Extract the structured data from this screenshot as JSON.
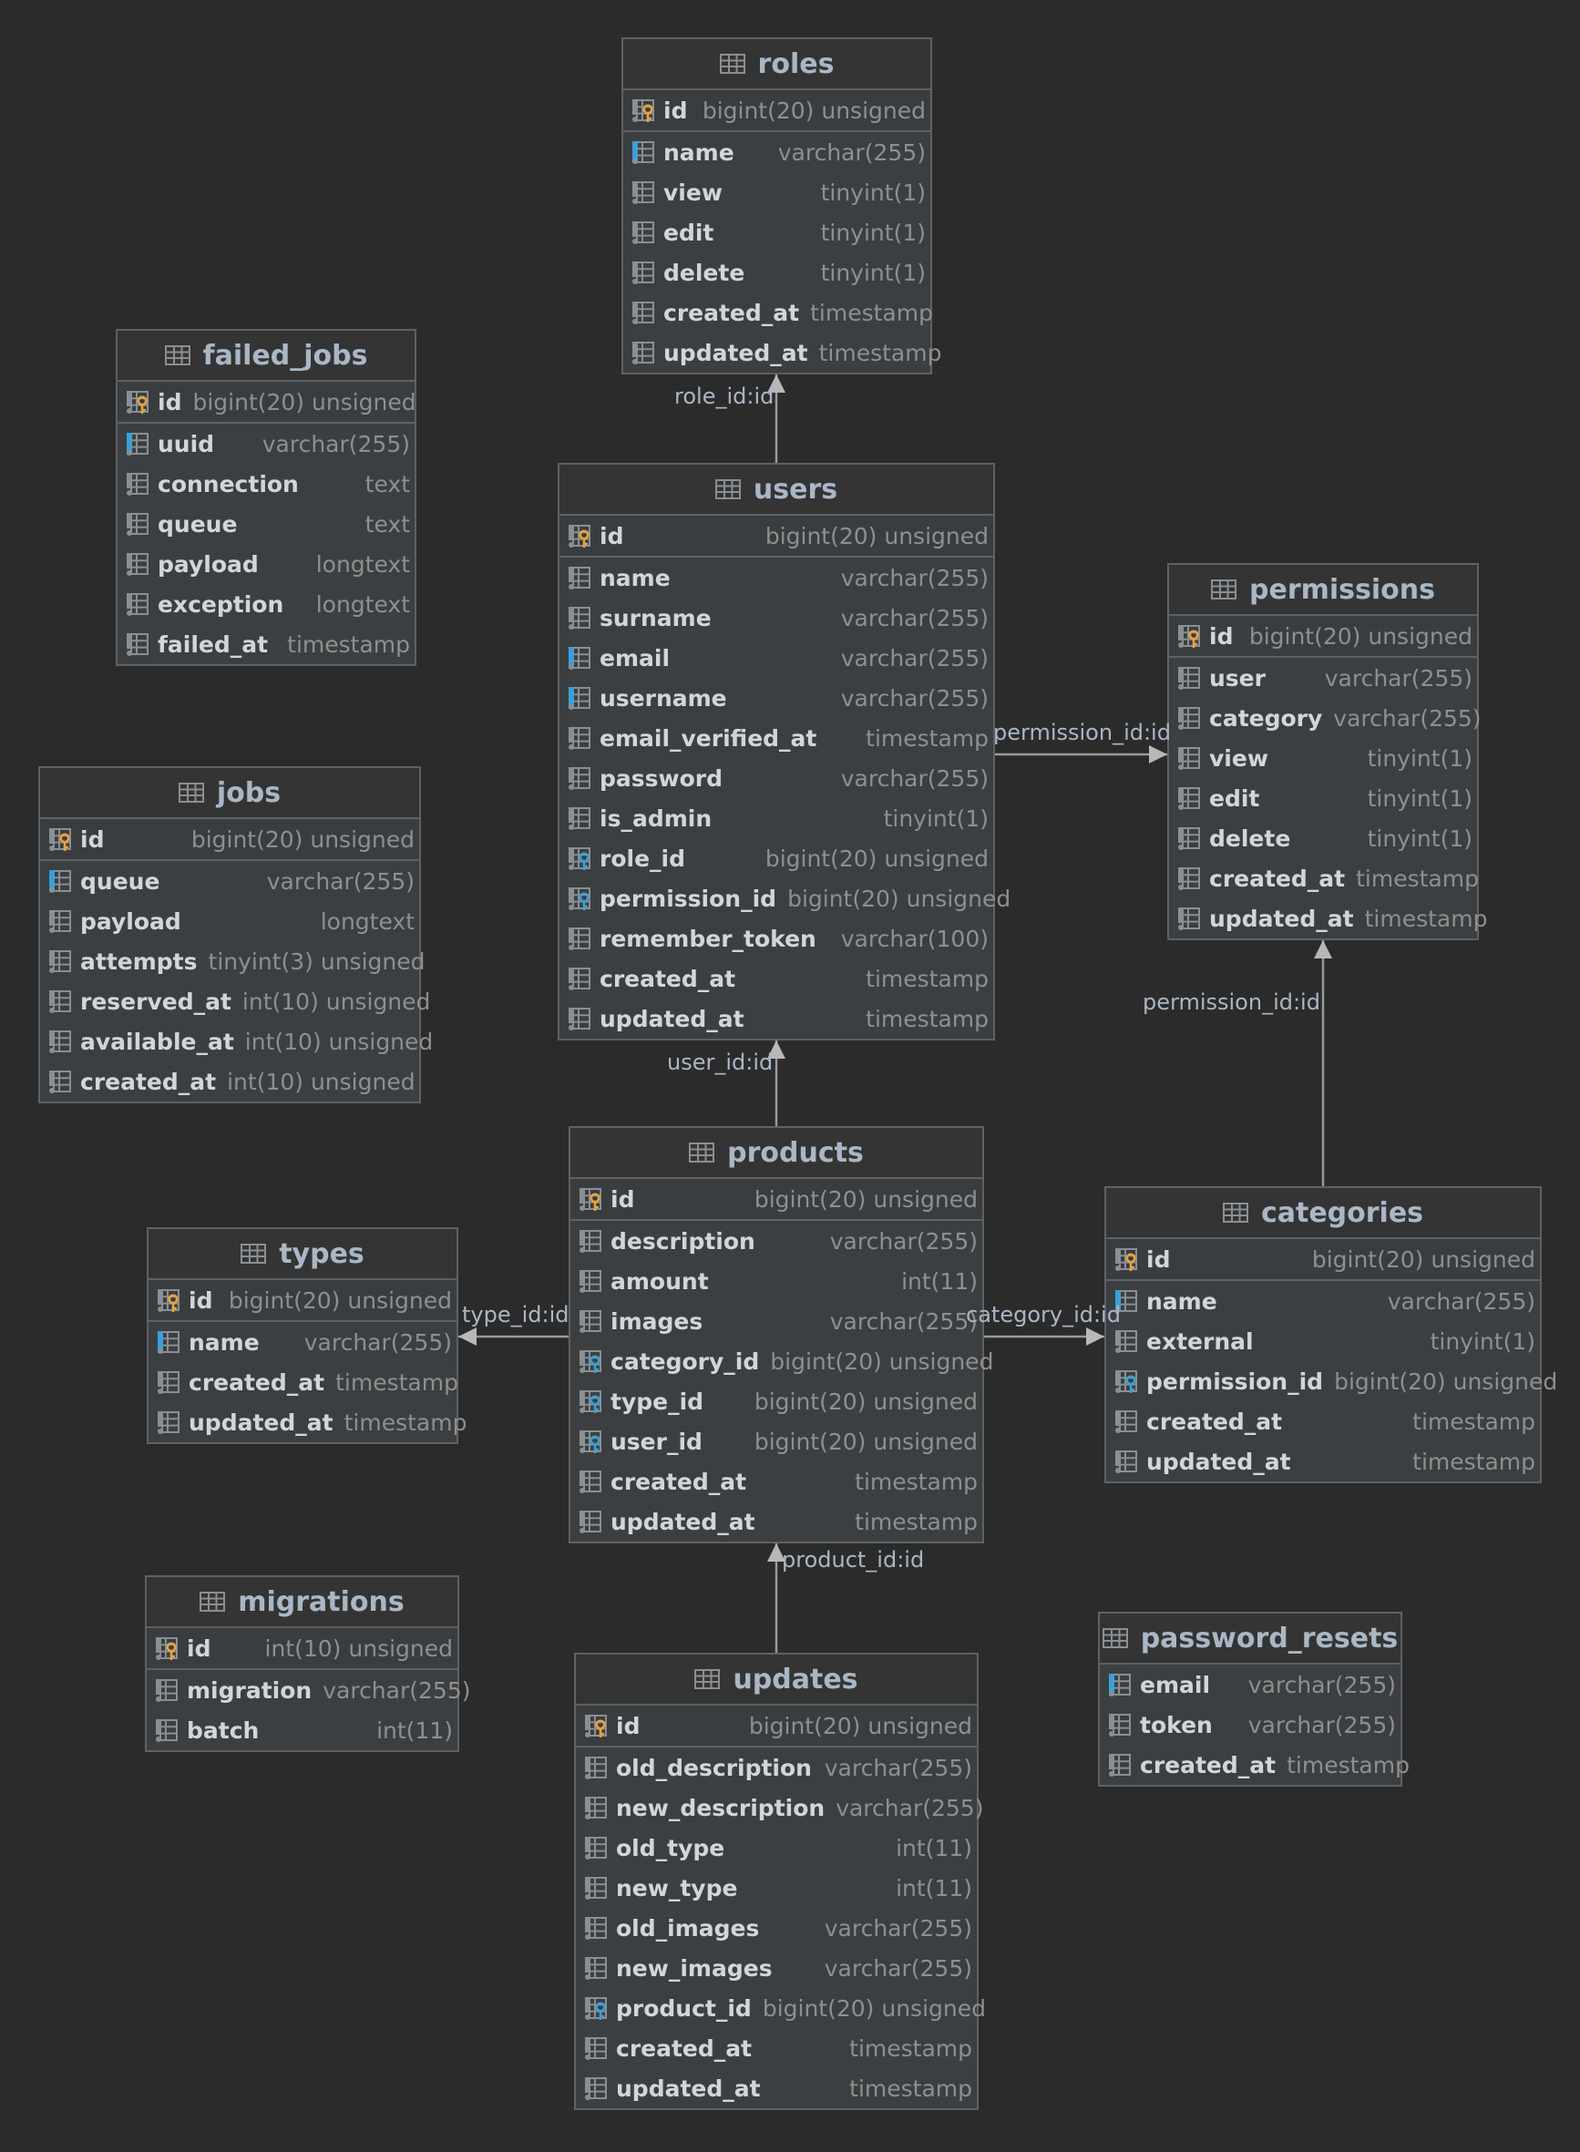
{
  "tables": [
    {
      "id": "roles",
      "name": "roles",
      "columns": [
        {
          "name": "id",
          "type": "bigint(20) unsigned",
          "kind": "pk"
        },
        {
          "name": "name",
          "type": "varchar(255)",
          "kind": "unique"
        },
        {
          "name": "view",
          "type": "tinyint(1)",
          "kind": "col"
        },
        {
          "name": "edit",
          "type": "tinyint(1)",
          "kind": "col"
        },
        {
          "name": "delete",
          "type": "tinyint(1)",
          "kind": "col"
        },
        {
          "name": "created_at",
          "type": "timestamp",
          "kind": "col"
        },
        {
          "name": "updated_at",
          "type": "timestamp",
          "kind": "col"
        }
      ]
    },
    {
      "id": "failed_jobs",
      "name": "failed_jobs",
      "columns": [
        {
          "name": "id",
          "type": "bigint(20) unsigned",
          "kind": "pk"
        },
        {
          "name": "uuid",
          "type": "varchar(255)",
          "kind": "unique"
        },
        {
          "name": "connection",
          "type": "text",
          "kind": "col"
        },
        {
          "name": "queue",
          "type": "text",
          "kind": "col"
        },
        {
          "name": "payload",
          "type": "longtext",
          "kind": "col"
        },
        {
          "name": "exception",
          "type": "longtext",
          "kind": "col"
        },
        {
          "name": "failed_at",
          "type": "timestamp",
          "kind": "col"
        }
      ]
    },
    {
      "id": "users",
      "name": "users",
      "columns": [
        {
          "name": "id",
          "type": "bigint(20) unsigned",
          "kind": "pk"
        },
        {
          "name": "name",
          "type": "varchar(255)",
          "kind": "col"
        },
        {
          "name": "surname",
          "type": "varchar(255)",
          "kind": "col"
        },
        {
          "name": "email",
          "type": "varchar(255)",
          "kind": "unique"
        },
        {
          "name": "username",
          "type": "varchar(255)",
          "kind": "unique"
        },
        {
          "name": "email_verified_at",
          "type": "timestamp",
          "kind": "col"
        },
        {
          "name": "password",
          "type": "varchar(255)",
          "kind": "col"
        },
        {
          "name": "is_admin",
          "type": "tinyint(1)",
          "kind": "col"
        },
        {
          "name": "role_id",
          "type": "bigint(20) unsigned",
          "kind": "fk"
        },
        {
          "name": "permission_id",
          "type": "bigint(20) unsigned",
          "kind": "fk"
        },
        {
          "name": "remember_token",
          "type": "varchar(100)",
          "kind": "col"
        },
        {
          "name": "created_at",
          "type": "timestamp",
          "kind": "col"
        },
        {
          "name": "updated_at",
          "type": "timestamp",
          "kind": "col"
        }
      ]
    },
    {
      "id": "permissions",
      "name": "permissions",
      "columns": [
        {
          "name": "id",
          "type": "bigint(20) unsigned",
          "kind": "pk"
        },
        {
          "name": "user",
          "type": "varchar(255)",
          "kind": "col"
        },
        {
          "name": "category",
          "type": "varchar(255)",
          "kind": "col"
        },
        {
          "name": "view",
          "type": "tinyint(1)",
          "kind": "col"
        },
        {
          "name": "edit",
          "type": "tinyint(1)",
          "kind": "col"
        },
        {
          "name": "delete",
          "type": "tinyint(1)",
          "kind": "col"
        },
        {
          "name": "created_at",
          "type": "timestamp",
          "kind": "col"
        },
        {
          "name": "updated_at",
          "type": "timestamp",
          "kind": "col"
        }
      ]
    },
    {
      "id": "jobs",
      "name": "jobs",
      "columns": [
        {
          "name": "id",
          "type": "bigint(20) unsigned",
          "kind": "pk"
        },
        {
          "name": "queue",
          "type": "varchar(255)",
          "kind": "unique"
        },
        {
          "name": "payload",
          "type": "longtext",
          "kind": "col"
        },
        {
          "name": "attempts",
          "type": "tinyint(3) unsigned",
          "kind": "col"
        },
        {
          "name": "reserved_at",
          "type": "int(10) unsigned",
          "kind": "col"
        },
        {
          "name": "available_at",
          "type": "int(10) unsigned",
          "kind": "col"
        },
        {
          "name": "created_at",
          "type": "int(10) unsigned",
          "kind": "col"
        }
      ]
    },
    {
      "id": "products",
      "name": "products",
      "columns": [
        {
          "name": "id",
          "type": "bigint(20) unsigned",
          "kind": "pk"
        },
        {
          "name": "description",
          "type": "varchar(255)",
          "kind": "col"
        },
        {
          "name": "amount",
          "type": "int(11)",
          "kind": "col"
        },
        {
          "name": "images",
          "type": "varchar(255)",
          "kind": "col"
        },
        {
          "name": "category_id",
          "type": "bigint(20) unsigned",
          "kind": "fk"
        },
        {
          "name": "type_id",
          "type": "bigint(20) unsigned",
          "kind": "fk"
        },
        {
          "name": "user_id",
          "type": "bigint(20) unsigned",
          "kind": "fk"
        },
        {
          "name": "created_at",
          "type": "timestamp",
          "kind": "col"
        },
        {
          "name": "updated_at",
          "type": "timestamp",
          "kind": "col"
        }
      ]
    },
    {
      "id": "types",
      "name": "types",
      "columns": [
        {
          "name": "id",
          "type": "bigint(20) unsigned",
          "kind": "pk"
        },
        {
          "name": "name",
          "type": "varchar(255)",
          "kind": "unique"
        },
        {
          "name": "created_at",
          "type": "timestamp",
          "kind": "col"
        },
        {
          "name": "updated_at",
          "type": "timestamp",
          "kind": "col"
        }
      ]
    },
    {
      "id": "categories",
      "name": "categories",
      "columns": [
        {
          "name": "id",
          "type": "bigint(20) unsigned",
          "kind": "pk"
        },
        {
          "name": "name",
          "type": "varchar(255)",
          "kind": "unique"
        },
        {
          "name": "external",
          "type": "tinyint(1)",
          "kind": "col"
        },
        {
          "name": "permission_id",
          "type": "bigint(20) unsigned",
          "kind": "fk"
        },
        {
          "name": "created_at",
          "type": "timestamp",
          "kind": "col"
        },
        {
          "name": "updated_at",
          "type": "timestamp",
          "kind": "col"
        }
      ]
    },
    {
      "id": "migrations",
      "name": "migrations",
      "columns": [
        {
          "name": "id",
          "type": "int(10) unsigned",
          "kind": "pk"
        },
        {
          "name": "migration",
          "type": "varchar(255)",
          "kind": "col"
        },
        {
          "name": "batch",
          "type": "int(11)",
          "kind": "col"
        }
      ]
    },
    {
      "id": "password_resets",
      "name": "password_resets",
      "columns": [
        {
          "name": "email",
          "type": "varchar(255)",
          "kind": "unique"
        },
        {
          "name": "token",
          "type": "varchar(255)",
          "kind": "col"
        },
        {
          "name": "created_at",
          "type": "timestamp",
          "kind": "col"
        }
      ]
    },
    {
      "id": "updates",
      "name": "updates",
      "columns": [
        {
          "name": "id",
          "type": "bigint(20) unsigned",
          "kind": "pk"
        },
        {
          "name": "old_description",
          "type": "varchar(255)",
          "kind": "col"
        },
        {
          "name": "new_description",
          "type": "varchar(255)",
          "kind": "col"
        },
        {
          "name": "old_type",
          "type": "int(11)",
          "kind": "col"
        },
        {
          "name": "new_type",
          "type": "int(11)",
          "kind": "col"
        },
        {
          "name": "old_images",
          "type": "varchar(255)",
          "kind": "col"
        },
        {
          "name": "new_images",
          "type": "varchar(255)",
          "kind": "col"
        },
        {
          "name": "product_id",
          "type": "bigint(20) unsigned",
          "kind": "fk"
        },
        {
          "name": "created_at",
          "type": "timestamp",
          "kind": "col"
        },
        {
          "name": "updated_at",
          "type": "timestamp",
          "kind": "col"
        }
      ]
    }
  ],
  "relations": [
    {
      "from": "users",
      "to": "roles",
      "label": "role_id:id"
    },
    {
      "from": "users",
      "to": "permissions",
      "label": "permission_id:id"
    },
    {
      "from": "products",
      "to": "users",
      "label": "user_id:id"
    },
    {
      "from": "products",
      "to": "types",
      "label": "type_id:id"
    },
    {
      "from": "products",
      "to": "categories",
      "label": "category_id:id"
    },
    {
      "from": "categories",
      "to": "permissions",
      "label": "permission_id:id"
    },
    {
      "from": "updates",
      "to": "products",
      "label": "product_id:id"
    }
  ],
  "colors": {
    "background": "#2b2b2b",
    "table": "#3c3f41",
    "border": "#5c6266",
    "column_name": "#cfd6dc",
    "column_type": "#8f8f8f",
    "primary_key": "#e8a33d",
    "foreign_key": "#3aa0d8",
    "unique_index": "#3aa0d8",
    "edge": "#9a9a9a"
  },
  "icons": {
    "table": "table-icon",
    "pk": "primary-key-column-icon",
    "fk": "foreign-key-column-icon",
    "unique": "indexed-column-icon",
    "col": "column-icon"
  }
}
